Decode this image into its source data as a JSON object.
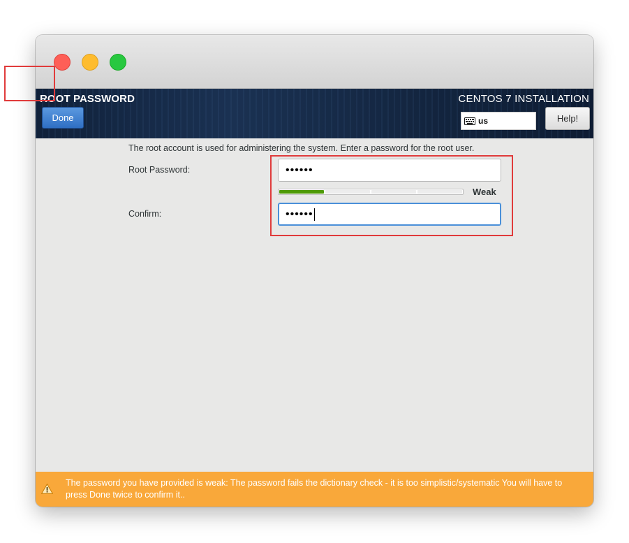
{
  "header": {
    "page_title": "ROOT PASSWORD",
    "done_label": "Done",
    "product_title": "CENTOS 7 INSTALLATION",
    "keyboard_layout": "us",
    "help_label": "Help!"
  },
  "form": {
    "description": "The root account is used for administering the system.  Enter a password for the root user.",
    "root_label": "Root Password:",
    "root_value": "••••••",
    "strength_label": "Weak",
    "strength_fraction": 0.25,
    "confirm_label": "Confirm:",
    "confirm_value": "••••••"
  },
  "warning": {
    "text": "The password you have provided is weak: The password fails the dictionary check - it is too simplistic/systematic You will have to press Done twice to confirm it.."
  },
  "icons": {
    "keyboard": "keyboard-icon",
    "warning": "warning-triangle-icon"
  },
  "colors": {
    "header_bg": "#13253f",
    "done_button": "#3a7bd5",
    "strength": "#4e9a06",
    "warning_bg": "#f9a83a",
    "highlight": "#e03b3b"
  }
}
